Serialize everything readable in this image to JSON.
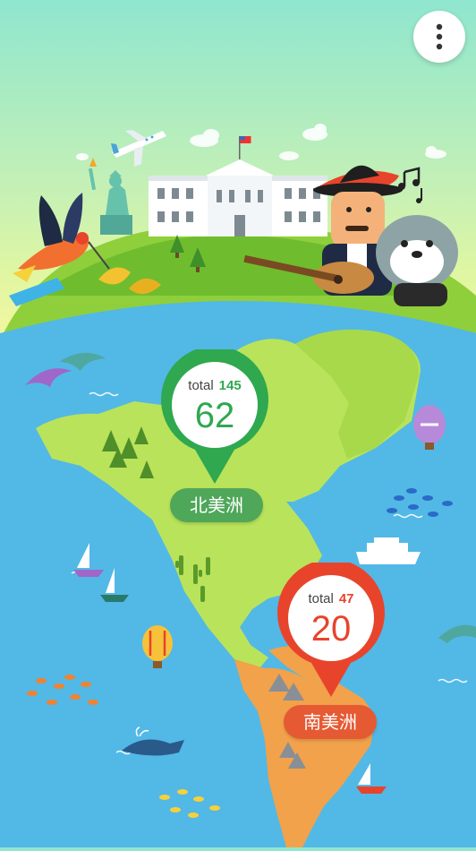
{
  "header": {
    "menu_icon": "more-vertical-icon"
  },
  "regions": [
    {
      "id": "north-america",
      "label": "北美洲",
      "total_label": "total",
      "total": "145",
      "count": "62",
      "color": "#2fa84f",
      "label_color": "#4fa75a"
    },
    {
      "id": "south-america",
      "label": "南美洲",
      "total_label": "total",
      "total": "47",
      "count": "20",
      "color": "#e8442c",
      "label_color": "#e65a33"
    }
  ],
  "colors": {
    "sky_top": "#8fe6cf",
    "ocean": "#52b8e6",
    "land": "#b9e35a",
    "south_land": "#f2a24a"
  }
}
